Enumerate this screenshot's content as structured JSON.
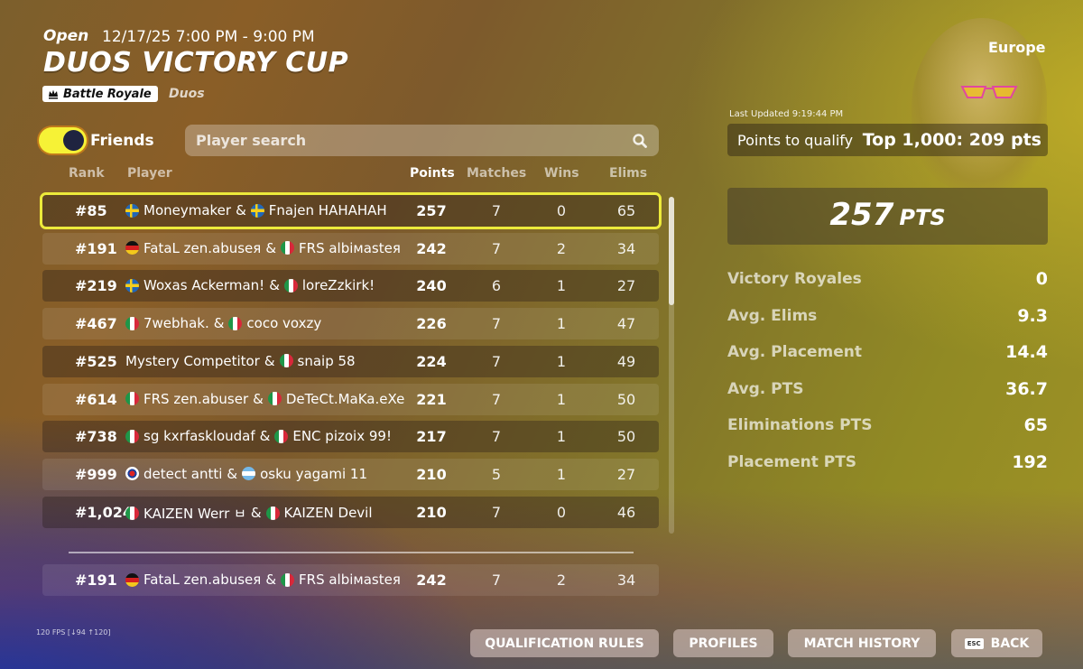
{
  "header": {
    "status": "Open",
    "time": "12/17/25 7:00 PM - 9:00 PM",
    "title": "DUOS VICTORY CUP",
    "mode": "Battle Royale",
    "team_mode": "Duos",
    "region": "Europe",
    "last_updated": "Last Updated 9:19:44 PM"
  },
  "filters": {
    "friends_label": "Friends",
    "friends_toggle_on": true,
    "search_placeholder": "Player search"
  },
  "table": {
    "headers": {
      "rank": "Rank",
      "player": "Player",
      "points": "Points",
      "matches": "Matches",
      "wins": "Wins",
      "elims": "Elims"
    },
    "rows": [
      {
        "rank": "#85",
        "p1": "Moneymaker",
        "p1_flag": "se",
        "sep": "&",
        "p2": "Fnajen HAHAHAH",
        "p2_flag": "se",
        "points": "257",
        "matches": "7",
        "wins": "0",
        "elims": "65"
      },
      {
        "rank": "#191",
        "p1": "FataL zen.abuseя",
        "p1_flag": "de",
        "sep": "&",
        "p2": "FRS albiмasteя",
        "p2_flag": "it",
        "points": "242",
        "matches": "7",
        "wins": "2",
        "elims": "34"
      },
      {
        "rank": "#219",
        "p1": "Woxas Ackerman!",
        "p1_flag": "se",
        "sep": "&",
        "p2": "loreZzkirk!",
        "p2_flag": "it",
        "points": "240",
        "matches": "6",
        "wins": "1",
        "elims": "27"
      },
      {
        "rank": "#467",
        "p1": "7webhak.",
        "p1_flag": "it",
        "sep": "&",
        "p2": "coco voxzy",
        "p2_flag": "it",
        "points": "226",
        "matches": "7",
        "wins": "1",
        "elims": "47"
      },
      {
        "rank": "#525",
        "p1": "Mystery Competitor",
        "p1_flag": "",
        "sep": "&",
        "p2": "snaip 58",
        "p2_flag": "it",
        "points": "224",
        "matches": "7",
        "wins": "1",
        "elims": "49"
      },
      {
        "rank": "#614",
        "p1": "FRS zen.abuser",
        "p1_flag": "it",
        "sep": "&",
        "p2": "DeTeCt.MaKa.eXe",
        "p2_flag": "it",
        "points": "221",
        "matches": "7",
        "wins": "1",
        "elims": "50"
      },
      {
        "rank": "#738",
        "p1": "sg kxrfaskloudaf",
        "p1_flag": "it",
        "sep": "&",
        "p2": "ENC pizoix 99!",
        "p2_flag": "it",
        "points": "217",
        "matches": "7",
        "wins": "1",
        "elims": "50"
      },
      {
        "rank": "#999",
        "p1": "detect antti",
        "p1_flag": "kr",
        "sep": "&",
        "p2": "osku yagami 11",
        "p2_flag": "ar",
        "points": "210",
        "matches": "5",
        "wins": "1",
        "elims": "27"
      },
      {
        "rank": "#1,024",
        "p1": "KAIZEN Werr ㅂ",
        "p1_flag": "it",
        "sep": "&",
        "p2": "KAIZEN Devil",
        "p2_flag": "it",
        "points": "210",
        "matches": "7",
        "wins": "0",
        "elims": "46"
      }
    ],
    "pinned": {
      "rank": "#191",
      "p1": "FataL zen.abuseя",
      "p1_flag": "de",
      "sep": "&",
      "p2": "FRS albiмasteя",
      "p2_flag": "it",
      "points": "242",
      "matches": "7",
      "wins": "2",
      "elims": "34"
    }
  },
  "summary": {
    "qualify_label": "Points to qualify",
    "qualify_value": "Top 1,000: 209 pts",
    "points_value": "257",
    "points_unit": "PTS",
    "stats": [
      {
        "label": "Victory Royales",
        "value": "0"
      },
      {
        "label": "Avg. Elims",
        "value": "9.3"
      },
      {
        "label": "Avg. Placement",
        "value": "14.4"
      },
      {
        "label": "Avg. PTS",
        "value": "36.7"
      },
      {
        "label": "Eliminations PTS",
        "value": "65"
      },
      {
        "label": "Placement PTS",
        "value": "192"
      }
    ]
  },
  "footer": {
    "fps": "120 FPS [↓94 ↑120]",
    "buttons": {
      "qualification_rules": "QUALIFICATION RULES",
      "profiles": "PROFILES",
      "match_history": "MATCH HISTORY",
      "esc_key": "ESC",
      "back": "BACK"
    }
  },
  "colors": {
    "highlight": "#ecea3b",
    "toggle": "#f6f236",
    "knob": "#1f2440"
  },
  "icons": {
    "mode": "crown-icon",
    "search": "magnifier-icon"
  }
}
